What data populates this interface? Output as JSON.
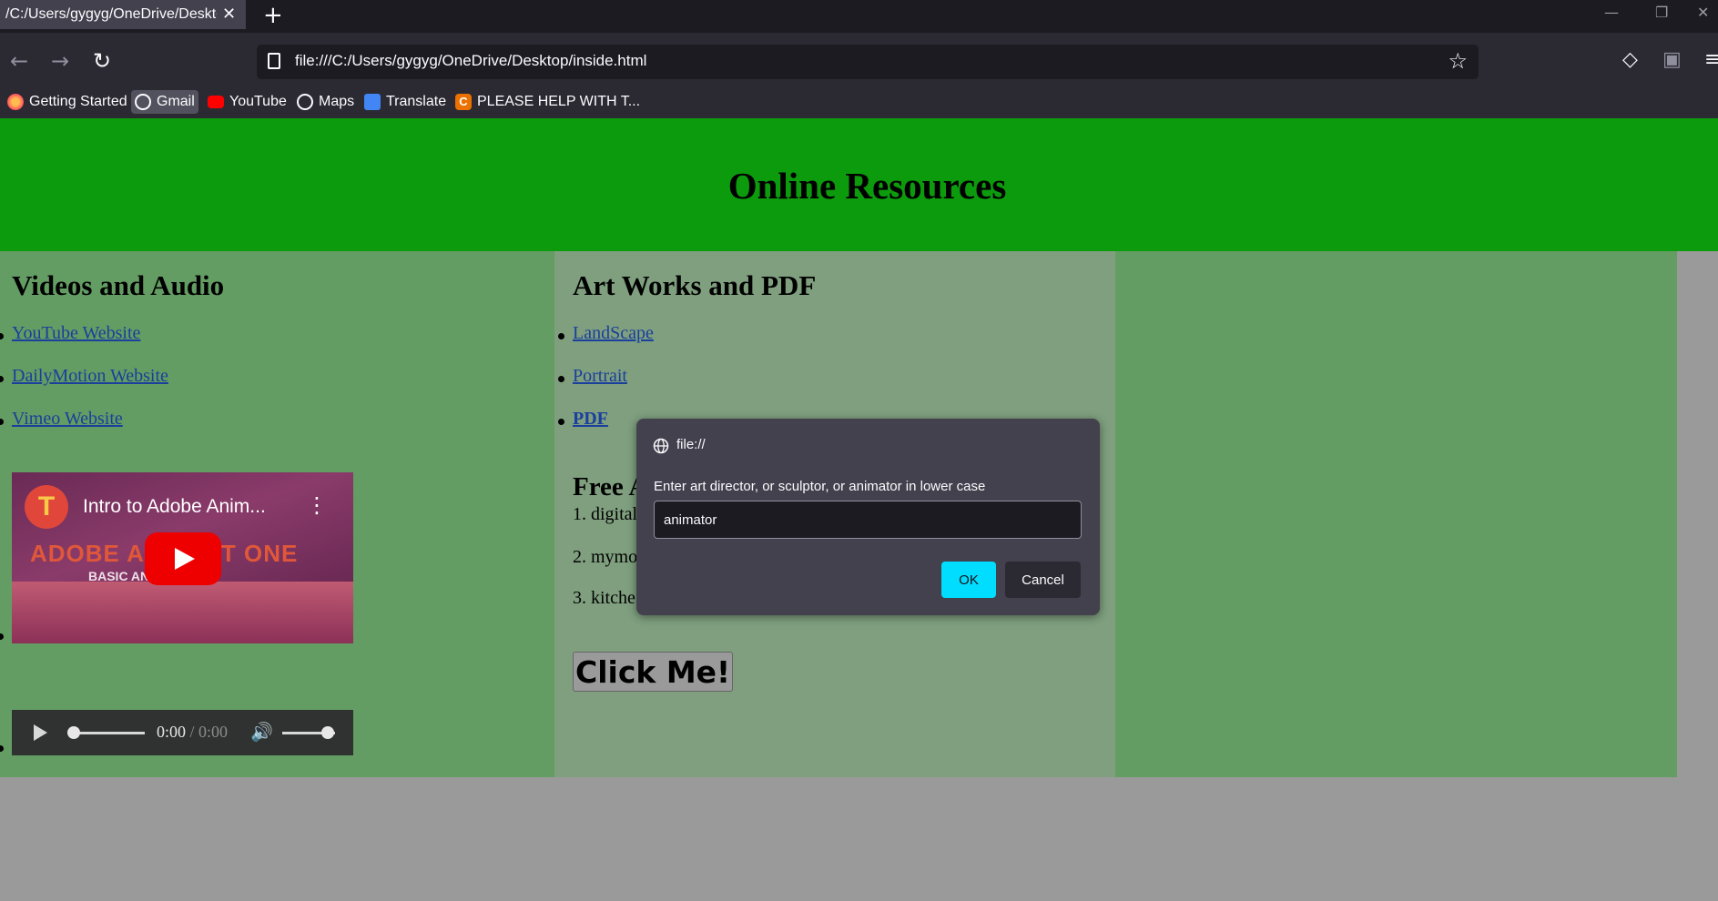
{
  "browser": {
    "tab_title": "/C:/Users/gygyg/OneDrive/Desktop/inside.html",
    "tab_close": "✕",
    "new_tab": "+",
    "url": "file:///C:/Users/gygyg/OneDrive/Desktop/inside.html",
    "window_controls": [
      "—",
      "❐",
      "✕"
    ],
    "bookmarks": [
      {
        "label": "Getting Started",
        "icon": "firefox-icon"
      },
      {
        "label": "Gmail",
        "icon": "globe-icon"
      },
      {
        "label": "YouTube",
        "icon": "youtube-icon"
      },
      {
        "label": "Maps",
        "icon": "globe-icon"
      },
      {
        "label": "Translate",
        "icon": "translate-icon"
      },
      {
        "label": "PLEASE HELP WITH T...",
        "icon": "chegg-icon"
      }
    ]
  },
  "page": {
    "title": "Online Resources",
    "col1": {
      "heading": "Videos and Audio",
      "links": [
        "YouTube Website",
        "DailyMotion Website",
        "Vimeo Website"
      ],
      "video": {
        "channel_letter": "T",
        "title": "Intro to Adobe Anim...",
        "more": "⋮",
        "banner_big": "ADOBE AN          PART ONE",
        "banner_small": "BASIC AN                ND SETUP"
      },
      "audio": {
        "current": "0:00",
        "separator": " / ",
        "duration": "0:00"
      }
    },
    "col2": {
      "heading": "Art Works and PDF",
      "links": [
        "LandScape",
        "Portrait",
        "PDF"
      ],
      "free_heading": "Free A",
      "list_items": [
        "1. digital",
        "2. mymo",
        "3. kitche"
      ],
      "button": "Click Me!"
    }
  },
  "dialog": {
    "origin": "file://",
    "message": "Enter art director, or sculptor, or animator in lower case",
    "input_value": "animator",
    "ok": "OK",
    "cancel": "Cancel"
  },
  "colors": {
    "header_green": "#0c9b0c",
    "col_green": "#639d63",
    "col_grey_green": "#7f9f7f",
    "ok_accent": "#00ddff"
  }
}
